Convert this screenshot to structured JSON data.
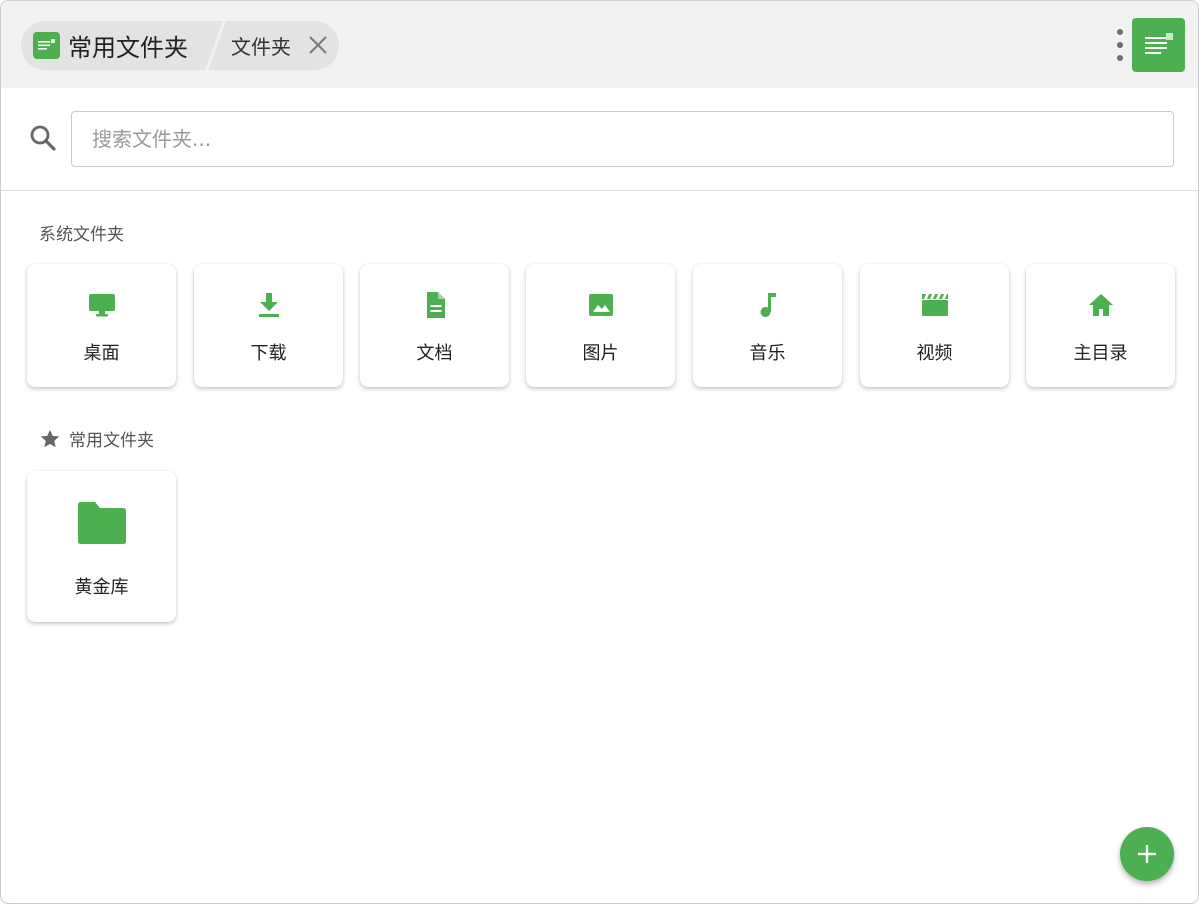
{
  "colors": {
    "accent": "#4caf50",
    "topbar_bg": "#f2f2f2",
    "crumb_bg": "#e3e3e3"
  },
  "breadcrumb": {
    "app_icon": "notes-app-icon",
    "main_label": "常用文件夹",
    "sub_label": "文件夹",
    "close_icon": "close-icon"
  },
  "toolbar": {
    "more_icon": "more-vertical-icon",
    "app_icon": "notes-app-icon"
  },
  "search": {
    "placeholder": "搜索文件夹...",
    "value": "",
    "icon": "search-icon"
  },
  "system_section": {
    "title": "系统文件夹",
    "items": [
      {
        "label": "桌面",
        "icon": "desktop-icon"
      },
      {
        "label": "下载",
        "icon": "download-icon"
      },
      {
        "label": "文档",
        "icon": "document-icon"
      },
      {
        "label": "图片",
        "icon": "image-icon"
      },
      {
        "label": "音乐",
        "icon": "music-icon"
      },
      {
        "label": "视频",
        "icon": "video-icon"
      },
      {
        "label": "主目录",
        "icon": "home-icon"
      }
    ]
  },
  "favorites_section": {
    "title": "常用文件夹",
    "icon": "star-icon",
    "items": [
      {
        "label": "黄金库",
        "icon": "folder-icon"
      }
    ]
  },
  "fab": {
    "icon": "plus-icon"
  }
}
